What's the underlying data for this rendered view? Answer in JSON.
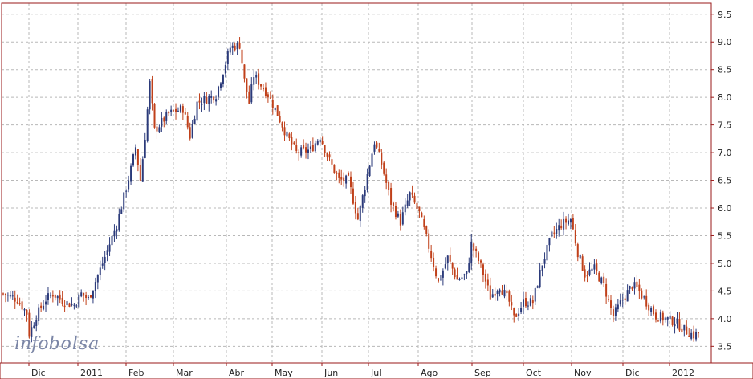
{
  "logo": {
    "text_a": "info",
    "text_b": "bolsa",
    "color": "#7b86a6"
  },
  "chart_data": {
    "type": "candlestick",
    "ylim": [
      3.2,
      9.7
    ],
    "y_ticks": [
      3.5,
      4.0,
      4.5,
      5.0,
      5.5,
      6.0,
      6.5,
      7.0,
      7.5,
      8.0,
      8.5,
      9.0,
      9.5
    ],
    "y_tick_labels": [
      "3.5",
      "4.0",
      "4.5",
      "5.0",
      "5.5",
      "6.0",
      "6.5",
      "7.0",
      "7.5",
      "8.0",
      "8.5",
      "9.0",
      "9.5"
    ],
    "x_tick_labels": [
      "Dic",
      "2011",
      "Feb",
      "Mar",
      "Abr",
      "May",
      "Jun",
      "Jul",
      "Ago",
      "Sep",
      "Oct",
      "Nov",
      "Dic",
      "2012"
    ],
    "grid": true,
    "colors": {
      "up": "#2b3a7a",
      "down": "#c0401a",
      "frame": "#9a1a1a",
      "grid": "#b8b8b8"
    },
    "series": [
      {
        "name": "",
        "price_path": [
          [
            0,
            4.45
          ],
          [
            6,
            4.35
          ],
          [
            10,
            4.1
          ],
          [
            11,
            3.72
          ],
          [
            14,
            4.05
          ],
          [
            18,
            4.35
          ],
          [
            21,
            4.45
          ],
          [
            26,
            4.3
          ],
          [
            30,
            4.25
          ],
          [
            33,
            4.45
          ],
          [
            36,
            4.35
          ],
          [
            42,
            5.0
          ],
          [
            48,
            5.7
          ],
          [
            54,
            6.7
          ],
          [
            56,
            7.1
          ],
          [
            58,
            6.5
          ],
          [
            60,
            7.3
          ],
          [
            62,
            8.25
          ],
          [
            64,
            7.4
          ],
          [
            70,
            7.7
          ],
          [
            76,
            7.8
          ],
          [
            79,
            7.3
          ],
          [
            82,
            7.9
          ],
          [
            90,
            8.05
          ],
          [
            96,
            8.9
          ],
          [
            100,
            8.95
          ],
          [
            102,
            8.3
          ],
          [
            104,
            7.9
          ],
          [
            106,
            8.4
          ],
          [
            112,
            8.05
          ],
          [
            116,
            7.7
          ],
          [
            120,
            7.3
          ],
          [
            124,
            7.0
          ],
          [
            130,
            7.05
          ],
          [
            134,
            7.3
          ],
          [
            138,
            6.85
          ],
          [
            142,
            6.5
          ],
          [
            146,
            6.5
          ],
          [
            150,
            5.8
          ],
          [
            154,
            6.6
          ],
          [
            157,
            7.2
          ],
          [
            160,
            6.8
          ],
          [
            164,
            6.1
          ],
          [
            168,
            5.75
          ],
          [
            172,
            6.25
          ],
          [
            176,
            5.9
          ],
          [
            180,
            5.3
          ],
          [
            184,
            4.65
          ],
          [
            188,
            5.1
          ],
          [
            192,
            4.7
          ],
          [
            196,
            4.8
          ],
          [
            198,
            5.35
          ],
          [
            202,
            4.95
          ],
          [
            206,
            4.4
          ],
          [
            210,
            4.6
          ],
          [
            214,
            4.3
          ],
          [
            216,
            4.0
          ],
          [
            220,
            4.3
          ],
          [
            224,
            4.3
          ],
          [
            228,
            5.0
          ],
          [
            232,
            5.5
          ],
          [
            236,
            5.7
          ],
          [
            240,
            5.8
          ],
          [
            243,
            5.2
          ],
          [
            246,
            4.8
          ],
          [
            250,
            4.9
          ],
          [
            254,
            4.6
          ],
          [
            258,
            4.05
          ],
          [
            262,
            4.35
          ],
          [
            266,
            4.6
          ],
          [
            268,
            4.55
          ],
          [
            272,
            4.3
          ],
          [
            276,
            4.05
          ],
          [
            280,
            4.0
          ],
          [
            284,
            3.95
          ],
          [
            288,
            3.8
          ],
          [
            292,
            3.7
          ],
          [
            294,
            3.75
          ]
        ]
      }
    ]
  }
}
